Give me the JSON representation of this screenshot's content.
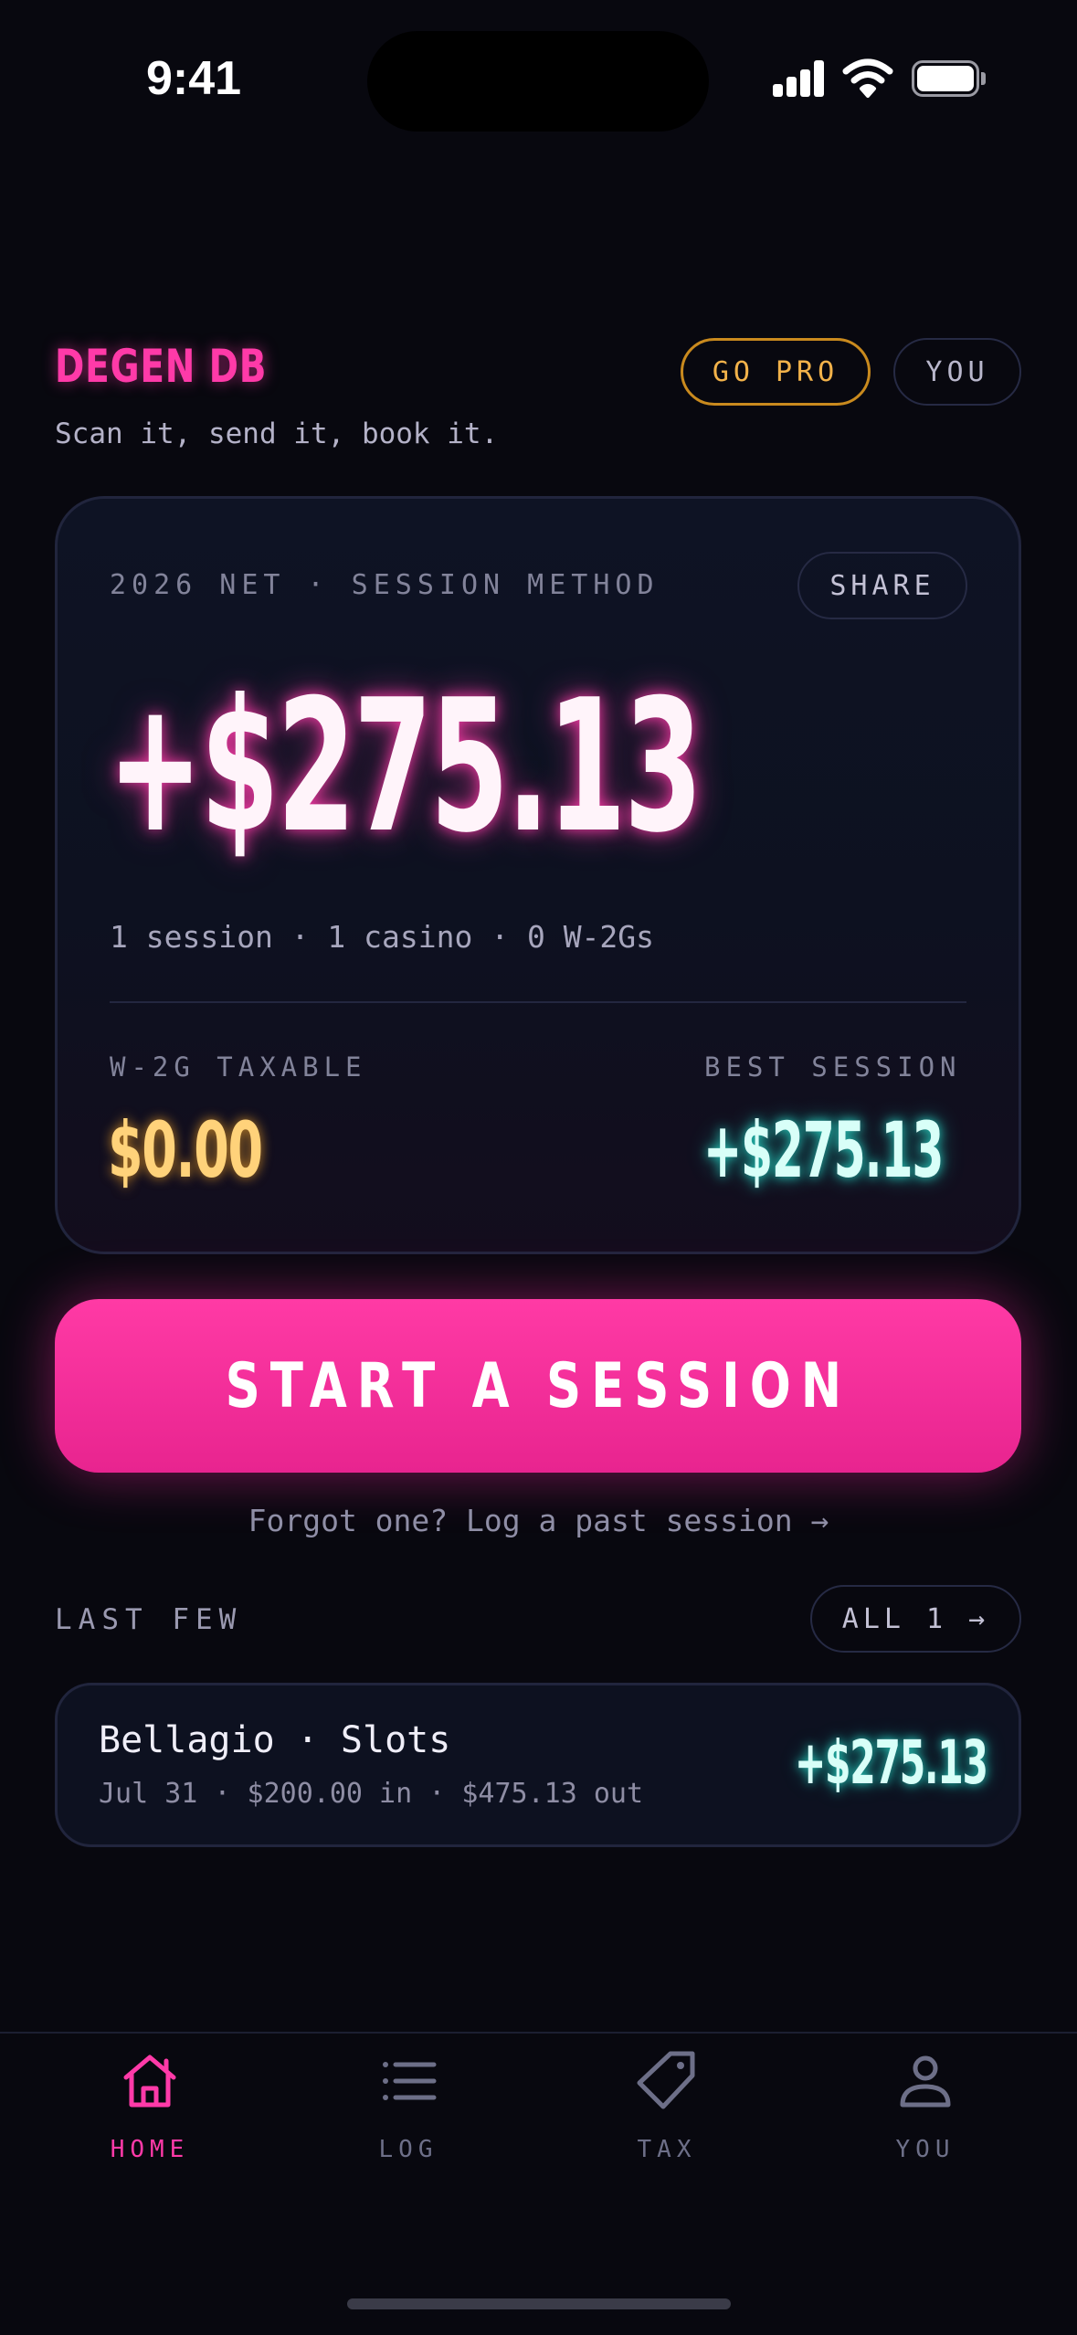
{
  "status_bar": {
    "time": "9:41"
  },
  "header": {
    "brand": "DEGEN DB",
    "tagline": "Scan it, send it, book it.",
    "go_pro_label": "GO PRO",
    "you_label": "YOU"
  },
  "net_card": {
    "label": "2026 NET · SESSION METHOD",
    "share_label": "SHARE",
    "net_amount": "+$275.13",
    "summary": "1 session · 1 casino · 0 W-2Gs",
    "w2g_label": "W-2G TAXABLE",
    "w2g_value": "$0.00",
    "best_label": "BEST SESSION",
    "best_value": "+$275.13"
  },
  "cta": {
    "start_label": "START A SESSION",
    "past_link": "Forgot one? Log a past session →"
  },
  "recent": {
    "label": "LAST FEW",
    "all_label": "ALL 1 →",
    "sessions": [
      {
        "title": "Bellagio · Slots",
        "detail": "Jul 31 · $200.00 in · $475.13 out",
        "amount": "+$275.13"
      }
    ]
  },
  "tabbar": {
    "tabs": [
      {
        "label": "HOME",
        "icon": "home-icon",
        "active": true
      },
      {
        "label": "LOG",
        "icon": "list-icon",
        "active": false
      },
      {
        "label": "TAX",
        "icon": "tag-icon",
        "active": false
      },
      {
        "label": "YOU",
        "icon": "person-icon",
        "active": false
      }
    ]
  },
  "colors": {
    "accent_pink": "#ff3aa8",
    "gold": "#f2b24a",
    "teal": "#28e6d2",
    "background": "#08080f"
  }
}
